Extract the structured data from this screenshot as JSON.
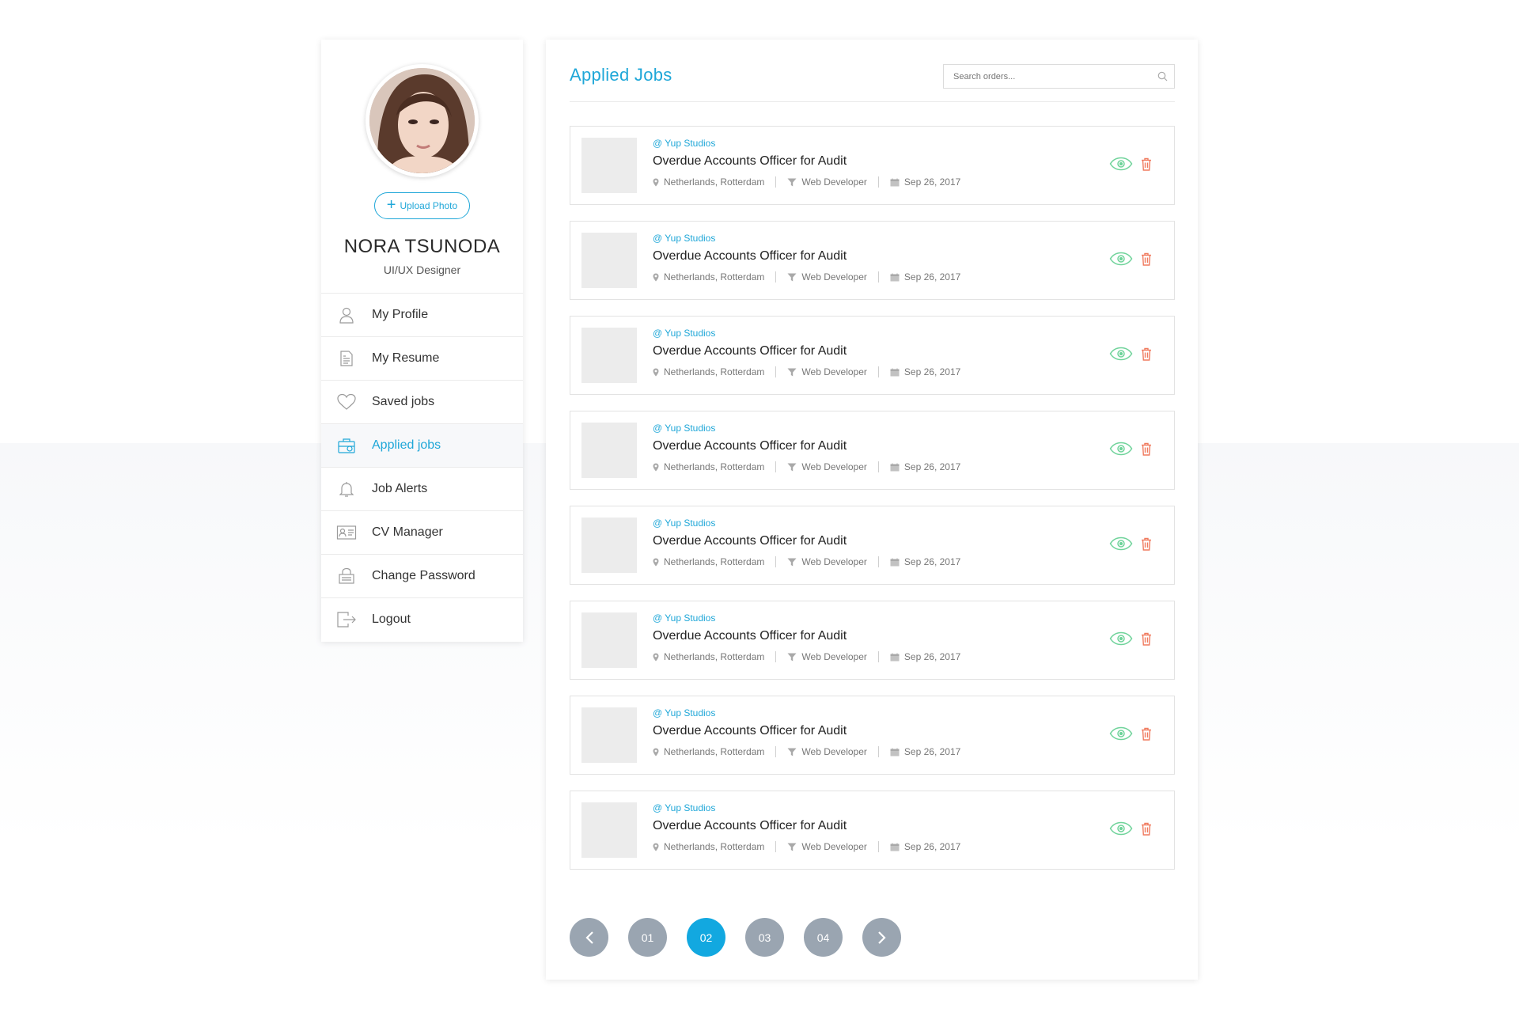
{
  "profile": {
    "name": "NORA TSUNODA",
    "role": "UI/UX Designer",
    "upload_label": "Upload Photo"
  },
  "menu": [
    {
      "label": "My Profile",
      "icon": "user-icon"
    },
    {
      "label": "My Resume",
      "icon": "resume-icon"
    },
    {
      "label": "Saved jobs",
      "icon": "heart-icon"
    },
    {
      "label": "Applied jobs",
      "icon": "briefcase-icon",
      "active": true
    },
    {
      "label": "Job Alerts",
      "icon": "bell-icon"
    },
    {
      "label": "CV Manager",
      "icon": "id-card-icon"
    },
    {
      "label": "Change Password",
      "icon": "lock-icon"
    },
    {
      "label": "Logout",
      "icon": "logout-icon"
    }
  ],
  "main": {
    "title": "Applied Jobs",
    "search_placeholder": "Search orders..."
  },
  "jobs": [
    {
      "company": "@ Yup Studios",
      "title": "Overdue Accounts Officer for Audit",
      "location": "Netherlands, Rotterdam",
      "category": "Web Developer",
      "date": "Sep 26, 2017"
    },
    {
      "company": "@ Yup Studios",
      "title": "Overdue Accounts Officer for Audit",
      "location": "Netherlands, Rotterdam",
      "category": "Web Developer",
      "date": "Sep 26, 2017"
    },
    {
      "company": "@ Yup Studios",
      "title": "Overdue Accounts Officer for Audit",
      "location": "Netherlands, Rotterdam",
      "category": "Web Developer",
      "date": "Sep 26, 2017"
    },
    {
      "company": "@ Yup Studios",
      "title": "Overdue Accounts Officer for Audit",
      "location": "Netherlands, Rotterdam",
      "category": "Web Developer",
      "date": "Sep 26, 2017"
    },
    {
      "company": "@ Yup Studios",
      "title": "Overdue Accounts Officer for Audit",
      "location": "Netherlands, Rotterdam",
      "category": "Web Developer",
      "date": "Sep 26, 2017"
    },
    {
      "company": "@ Yup Studios",
      "title": "Overdue Accounts Officer for Audit",
      "location": "Netherlands, Rotterdam",
      "category": "Web Developer",
      "date": "Sep 26, 2017"
    },
    {
      "company": "@ Yup Studios",
      "title": "Overdue Accounts Officer for Audit",
      "location": "Netherlands, Rotterdam",
      "category": "Web Developer",
      "date": "Sep 26, 2017"
    },
    {
      "company": "@ Yup Studios",
      "title": "Overdue Accounts Officer for Audit",
      "location": "Netherlands, Rotterdam",
      "category": "Web Developer",
      "date": "Sep 26, 2017"
    }
  ],
  "pagination": {
    "pages": [
      "01",
      "02",
      "03",
      "04"
    ],
    "active": "02"
  },
  "colors": {
    "accent": "#1fa7d8",
    "view_icon": "#6fd39a",
    "delete_icon": "#f07a5e",
    "pager_inactive": "#9aa5b1",
    "pager_active": "#12a8e0"
  }
}
